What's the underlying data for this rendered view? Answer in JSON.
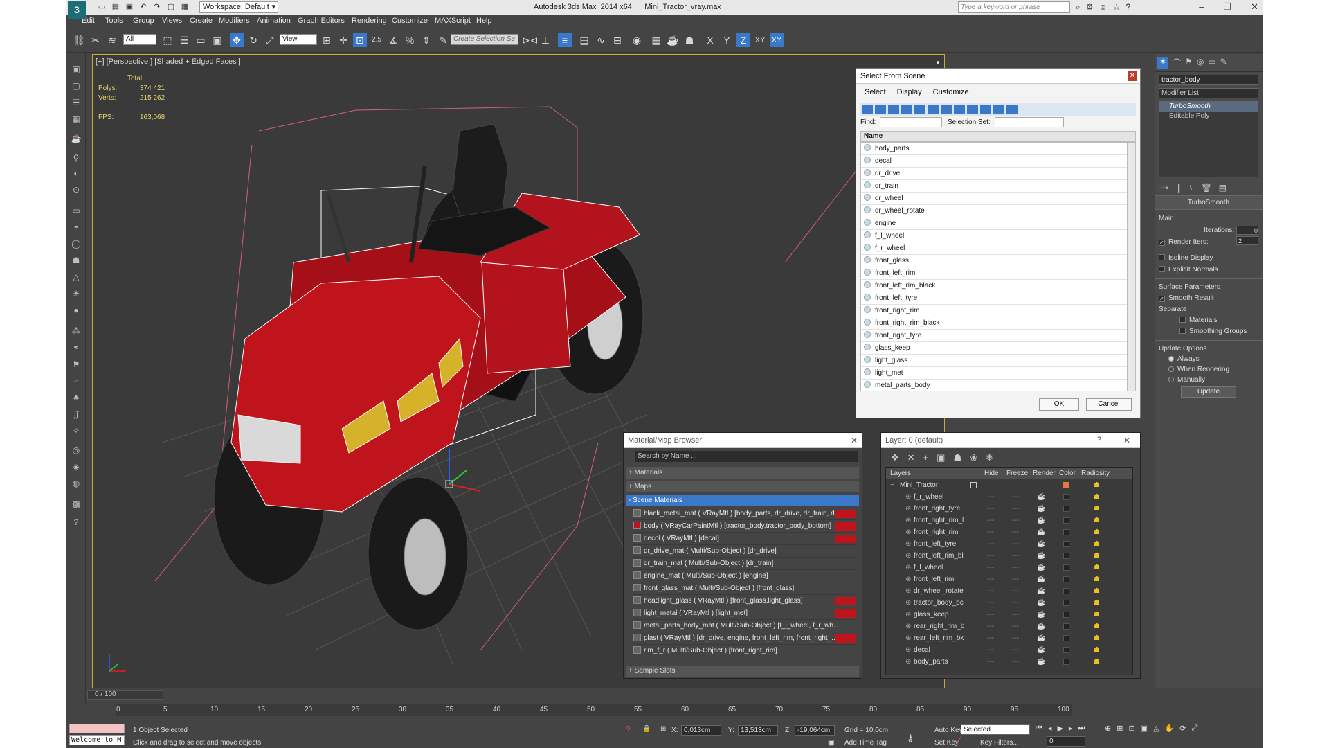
{
  "app": {
    "title": "Autodesk 3ds Max  2014 x64",
    "file": "Mini_Tractor_vray.max",
    "workspace": "Workspace: Default",
    "search_placeholder": "Type a keyword or phrase"
  },
  "menu": [
    "Edit",
    "Tools",
    "Group",
    "Views",
    "Create",
    "Modifiers",
    "Animation",
    "Graph Editors",
    "Rendering",
    "Customize",
    "MAXScript",
    "Help"
  ],
  "toolbar": {
    "selection_filter": "All",
    "ref_coord": "View",
    "named_selection_placeholder": "Create Selection Se",
    "snap_label": "2.5",
    "axis_x": "X",
    "axis_y": "Y",
    "axis_z": "Z",
    "axis_xy": "XY",
    "axis_xy2": "XY"
  },
  "viewport": {
    "label": "[+] [Perspective ] [Shaded + Edged Faces ]",
    "stats_header": "Total",
    "polys_label": "Polys:",
    "polys_value": "374 421",
    "verts_label": "Verts:",
    "verts_value": "215 262",
    "fps_label": "FPS:",
    "fps_value": "163,068"
  },
  "select_from_scene": {
    "title": "Select From Scene",
    "menu": [
      "Select",
      "Display",
      "Customize"
    ],
    "find_label": "Find:",
    "selection_set_label": "Selection Set:",
    "column_name": "Name",
    "items": [
      "body_parts",
      "decal",
      "dr_drive",
      "dr_train",
      "dr_wheel",
      "dr_wheel_rotate",
      "engine",
      "f_l_wheel",
      "f_r_wheel",
      "front_glass",
      "front_left_rim",
      "front_left_rim_black",
      "front_left_tyre",
      "front_right_rim",
      "front_right_rim_black",
      "front_right_tyre",
      "glass_keep",
      "light_glass",
      "light_met",
      "metal_parts_body"
    ],
    "ok": "OK",
    "cancel": "Cancel"
  },
  "material_browser": {
    "title": "Material/Map Browser",
    "search_placeholder": "Search by Name ...",
    "sections": {
      "materials": "+ Materials",
      "maps": "+ Maps",
      "scene": "- Scene Materials",
      "sample": "+ Sample Slots"
    },
    "items": [
      "black_metal_mat  ( VRayMtl ) [body_parts, dr_drive, dr_train, d...",
      "body  ( VRayCarPaintMtl ) [tractor_body,tractor_body_bottom]",
      "decol  ( VRayMtl ) [decal]",
      "dr_drive_mat  ( Multi/Sub-Object ) [dr_drive]",
      "dr_train_mat  ( Multi/Sub-Object ) [dr_train]",
      "engine_mat  ( Multi/Sub-Object ) [engine]",
      "front_glass_mat  ( Multi/Sub-Object ) [front_glass]",
      "headlight_glass  ( VRayMtl ) [front_glass,light_glass]",
      "light_metal  ( VRayMtl ) [light_met]",
      "metal_parts_body_mat  ( Multi/Sub-Object ) [f_l_wheel, f_r_wh...",
      "plast  ( VRayMtl ) [dr_drive, engine, front_left_rim, front_right_...",
      "rim_f_r  ( Multi/Sub-Object ) [front_right_rim]"
    ]
  },
  "layer_manager": {
    "title": "Layer: 0 (default)",
    "help": "?",
    "columns": [
      "Layers",
      "Hide",
      "Freeze",
      "Render",
      "Color",
      "Radiosity"
    ],
    "root": "Mini_Tractor",
    "items": [
      "f_r_wheel",
      "front_right_tyre",
      "front_right_rim_l",
      "front_right_rim",
      "front_left_tyre",
      "front_left_rim_bl",
      "f_l_wheel",
      "front_left_rim",
      "dr_wheel_rotate",
      "tractor_body_bc",
      "glass_keep",
      "rear_right_rim_b",
      "rear_left_rim_bk",
      "decal",
      "body_parts"
    ]
  },
  "command_panel": {
    "object_name": "tractor_body",
    "modifier_list": "Modifier List",
    "stack": [
      "TurboSmooth",
      "Editable Poly"
    ],
    "rollout_title": "TurboSmooth",
    "main_label": "Main",
    "iterations_label": "Iterations:",
    "iterations_value": "0",
    "render_iters_label": "Render Iters:",
    "render_iters_value": "2",
    "isoline": "Isoline Display",
    "explicit_normals": "Explicit Normals",
    "surface_params": "Surface Parameters",
    "smooth_result": "Smooth Result",
    "separate": "Separate",
    "materials": "Materials",
    "smoothing_groups": "Smoothing Groups",
    "update_options": "Update Options",
    "always": "Always",
    "when_rendering": "When Rendering",
    "manually": "Manually",
    "update_btn": "Update"
  },
  "timeline": {
    "frame": "0 / 100",
    "ticks": [
      "0",
      "5",
      "10",
      "15",
      "20",
      "25",
      "30",
      "35",
      "40",
      "45",
      "50",
      "55",
      "60",
      "65",
      "70",
      "75",
      "80",
      "85",
      "90",
      "95",
      "100"
    ]
  },
  "status": {
    "welcome": "Welcome to M",
    "selected": "1 Object Selected",
    "hint": "Click and drag to select and move objects",
    "x_label": "X:",
    "x_value": "0,013cm",
    "y_label": "Y:",
    "y_value": "13,513cm",
    "z_label": "Z:",
    "z_value": "-19,064cm",
    "grid": "Grid = 10,0cm",
    "add_time_tag": "Add Time Tag",
    "auto_key": "Auto Key",
    "set_key": "Set Key",
    "selected_dropdown": "Selected",
    "key_filters": "Key Filters...",
    "frame_value": "0"
  },
  "colors": {
    "accent_blue": "#3a78c9",
    "body_red": "#c0141c",
    "viewport_border": "#c9a93c"
  }
}
